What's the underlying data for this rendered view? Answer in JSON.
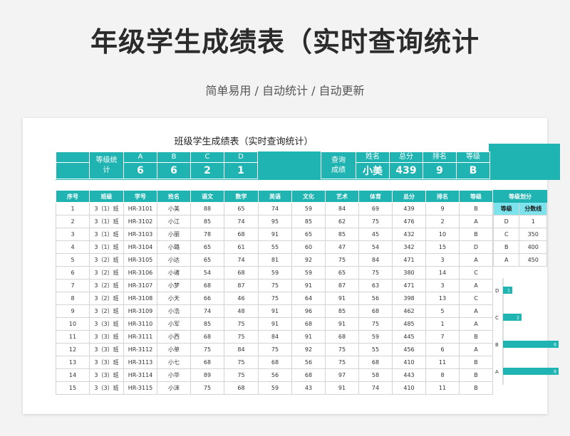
{
  "main_title": "年级学生成绩表（实时查询统计",
  "subtitle": "简单易用  /  自动统计  /  自动更新",
  "sheet_title": "班级学生成绩表（实时查询统计）",
  "grade_stats": {
    "label": "等级统计",
    "grades": [
      "A",
      "B",
      "C",
      "D"
    ],
    "counts": [
      "6",
      "6",
      "2",
      "1"
    ]
  },
  "query": {
    "label": "查询成绩",
    "headers": [
      "姓名",
      "总分",
      "排名",
      "等级"
    ],
    "values": [
      "小美",
      "439",
      "9",
      "B"
    ]
  },
  "table": {
    "headers": [
      "序号",
      "班级",
      "学号",
      "姓名",
      "语文",
      "数学",
      "英语",
      "文化",
      "艺术",
      "体育",
      "总分",
      "排名",
      "等级"
    ],
    "rows": [
      [
        "1",
        "3（1）班",
        "HR-3101",
        "小美",
        "88",
        "65",
        "74",
        "59",
        "84",
        "69",
        "439",
        "9",
        "B"
      ],
      [
        "2",
        "3（1）班",
        "HR-3102",
        "小江",
        "85",
        "74",
        "95",
        "85",
        "62",
        "75",
        "476",
        "2",
        "A"
      ],
      [
        "3",
        "3（1）班",
        "HR-3103",
        "小丽",
        "78",
        "68",
        "91",
        "65",
        "85",
        "45",
        "432",
        "10",
        "B"
      ],
      [
        "4",
        "3（1）班",
        "HR-3104",
        "小璐",
        "65",
        "61",
        "55",
        "60",
        "47",
        "54",
        "342",
        "15",
        "D"
      ],
      [
        "5",
        "3（2）班",
        "HR-3105",
        "小达",
        "65",
        "74",
        "81",
        "92",
        "75",
        "84",
        "471",
        "3",
        "A"
      ],
      [
        "6",
        "3（2）班",
        "HR-3106",
        "小诸",
        "54",
        "68",
        "59",
        "59",
        "65",
        "75",
        "380",
        "14",
        "C"
      ],
      [
        "7",
        "3（2）班",
        "HR-3107",
        "小梦",
        "68",
        "87",
        "75",
        "91",
        "87",
        "63",
        "471",
        "3",
        "A"
      ],
      [
        "8",
        "3（2）班",
        "HR-3108",
        "小天",
        "66",
        "46",
        "75",
        "64",
        "91",
        "56",
        "398",
        "13",
        "C"
      ],
      [
        "9",
        "3（2）班",
        "HR-3109",
        "小浩",
        "74",
        "48",
        "91",
        "96",
        "85",
        "68",
        "462",
        "5",
        "A"
      ],
      [
        "10",
        "3（3）班",
        "HR-3110",
        "小军",
        "85",
        "75",
        "91",
        "68",
        "91",
        "75",
        "485",
        "1",
        "A"
      ],
      [
        "11",
        "3（3）班",
        "HR-3111",
        "小西",
        "68",
        "75",
        "84",
        "91",
        "68",
        "59",
        "445",
        "7",
        "B"
      ],
      [
        "12",
        "3（3）班",
        "HR-3112",
        "小单",
        "75",
        "84",
        "75",
        "92",
        "75",
        "55",
        "456",
        "6",
        "A"
      ],
      [
        "13",
        "3（3）班",
        "HR-3113",
        "小七",
        "68",
        "75",
        "68",
        "56",
        "75",
        "68",
        "410",
        "11",
        "B"
      ],
      [
        "14",
        "3（3）班",
        "HR-3114",
        "小华",
        "89",
        "75",
        "56",
        "68",
        "97",
        "58",
        "443",
        "8",
        "B"
      ],
      [
        "15",
        "3（3）班",
        "HR-3115",
        "小沫",
        "75",
        "68",
        "59",
        "43",
        "91",
        "74",
        "410",
        "11",
        "B"
      ]
    ]
  },
  "grade_division": {
    "title": "等级划分",
    "headers": [
      "等级",
      "分数线"
    ],
    "rows": [
      [
        "D",
        "1"
      ],
      [
        "C",
        "350"
      ],
      [
        "B",
        "400"
      ],
      [
        "A",
        "450"
      ]
    ]
  },
  "chart_data": {
    "type": "bar",
    "orientation": "horizontal",
    "categories": [
      "D",
      "C",
      "B",
      "A"
    ],
    "values": [
      1,
      2,
      6,
      6
    ],
    "color": "#1fb3b1"
  },
  "colors": {
    "accent": "#1fb3b1",
    "accent_light": "#7de3ec"
  }
}
